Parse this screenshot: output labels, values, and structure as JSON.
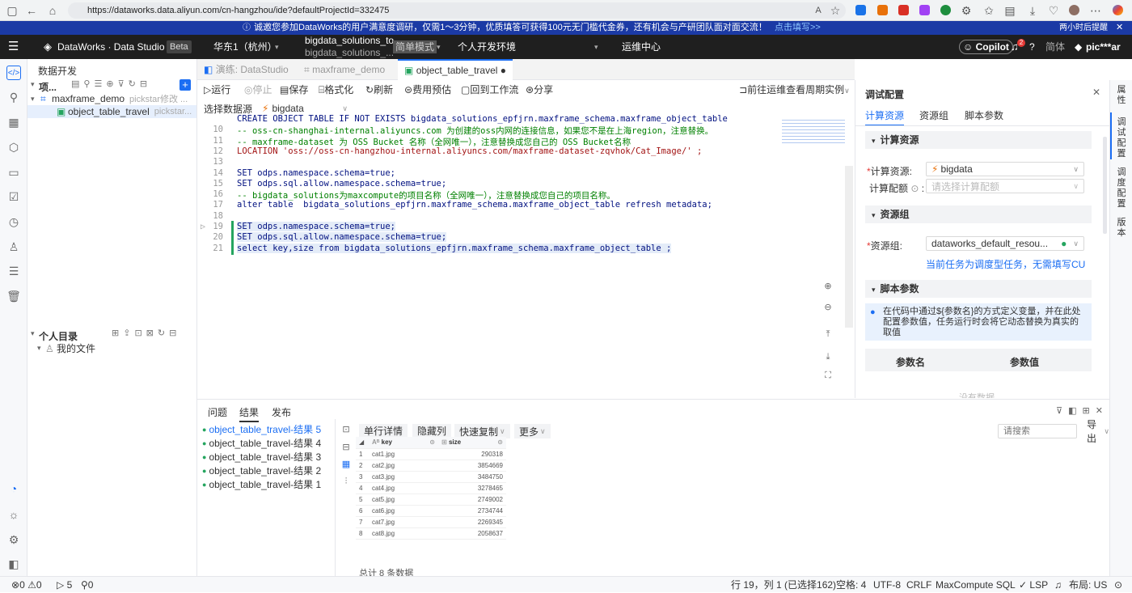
{
  "browser": {
    "url": "https://dataworks.data.aliyun.com/cn-hangzhou/ide?defaultProjectId=332475"
  },
  "banner": {
    "text": "诚邀您参加DataWorks的用户满意度调研，仅需1～3分钟，优质填答可获得100元无门槛代金券，还有机会与产研团队面对面交流！",
    "link": "点击填写>>",
    "dismiss": "两小时后提醒"
  },
  "header": {
    "product": "DataWorks · Data Studio",
    "beta": "Beta",
    "region": "华东1（杭州）",
    "project_line1": "bigdata_solutions_to",
    "project_line2": "bigdata_solutions_...",
    "mode": "简单模式",
    "env": "个人开发环境",
    "ops": "运维中心",
    "copilot": "Copilot",
    "notif_count": "2",
    "lang": "简体",
    "user": "pic***ar"
  },
  "explorer": {
    "title": "数据开发",
    "project_label": "项...",
    "tree": [
      {
        "label": "maxframe_demo",
        "meta": "pickstar修改 ..."
      },
      {
        "label": "object_table_travel",
        "meta": "pickstar..."
      }
    ],
    "personal_title": "个人目录",
    "my_files": "我的文件"
  },
  "tabs": [
    {
      "label": "演练: DataStudio"
    },
    {
      "label": "maxframe_demo"
    },
    {
      "label": "object_table_travel"
    }
  ],
  "toolbar": {
    "run": "运行",
    "stop": "停止",
    "save": "保存",
    "format": "格式化",
    "refresh": "刷新",
    "cost": "费用预估",
    "back": "回到工作流",
    "share": "分享",
    "ops_link": "前往运维查看周期实例"
  },
  "datasource": {
    "label": "选择数据源",
    "value": "bigdata"
  },
  "code": {
    "lines": [
      {
        "n": "",
        "text": "CREATE OBJECT TABLE IF NOT EXISTS bigdata_solutions_epfjrn.maxframe_schema.maxframe_object_table"
      },
      {
        "n": "10",
        "text": "-- oss-cn-shanghai-internal.aliyuncs.com 为创建的oss内网的连接信息，如果您不是在上海region，注意替换。"
      },
      {
        "n": "11",
        "text": "-- maxframe-dataset 为 OSS Bucket 名称（全网唯一），注意替换成您自己的 OSS Bucket名称"
      },
      {
        "n": "12",
        "text": "LOCATION 'oss://oss-cn-hangzhou-internal.aliyuncs.com/maxframe-dataset-zqvhok/Cat_Image/' ;"
      },
      {
        "n": "13",
        "text": ""
      },
      {
        "n": "14",
        "text": "SET odps.namespace.schema=true;"
      },
      {
        "n": "15",
        "text": "SET odps.sql.allow.namespace.schema=true;"
      },
      {
        "n": "16",
        "text": "-- bigdata_solutions为maxcompute的项目名称（全网唯一），注意替换成您自己的项目名称。"
      },
      {
        "n": "17",
        "text": "alter table  bigdata_solutions_epfjrn.maxframe_schema.maxframe_object_table refresh metadata;"
      },
      {
        "n": "18",
        "text": ""
      },
      {
        "n": "19",
        "text": "SET odps.namespace.schema=true;"
      },
      {
        "n": "20",
        "text": "SET odps.sql.allow.namespace.schema=true;"
      },
      {
        "n": "21",
        "text": "select key,size from bigdata_solutions_epfjrn.maxframe_schema.maxframe_object_table ;"
      }
    ]
  },
  "right_panel": {
    "title": "调试配置",
    "tabs": [
      "计算资源",
      "资源组",
      "脚本参数"
    ],
    "compute_section": "计算资源",
    "compute_label": "计算资源:",
    "compute_value": "bigdata",
    "quota_label": "计算配额",
    "quota_placeholder": "请选择计算配额",
    "rg_section": "资源组",
    "rg_label": "资源组:",
    "rg_value": "dataworks_default_resou...",
    "rg_hint": "当前任务为调度型任务，无需填写CU",
    "param_section": "脚本参数",
    "param_info": "在代码中通过${参数名}的方式定义变量，并在此处配置参数值，任务运行时会将它动态替换为真实的取值",
    "param_col1": "参数名",
    "param_col2": "参数值",
    "no_data": "没有数据"
  },
  "right_rail": [
    "属性",
    "调试配置",
    "调度配置",
    "版本"
  ],
  "bottom": {
    "tabs": [
      "问题",
      "结果",
      "发布"
    ],
    "results": [
      "object_table_travel-结果 5",
      "object_table_travel-结果 4",
      "object_table_travel-结果 3",
      "object_table_travel-结果 2",
      "object_table_travel-结果 1"
    ],
    "actions": {
      "row_detail": "单行详情",
      "hide_col": "隐藏列",
      "quick_copy": "快速复制",
      "more": "更多",
      "search_placeholder": "请搜索",
      "export": "导出"
    },
    "table": {
      "columns": [
        "key",
        "size"
      ],
      "rows": [
        [
          "1",
          "cat1.jpg",
          "290318"
        ],
        [
          "2",
          "cat2.jpg",
          "3854669"
        ],
        [
          "3",
          "cat3.jpg",
          "3484750"
        ],
        [
          "4",
          "cat4.jpg",
          "3278465"
        ],
        [
          "5",
          "cat5.jpg",
          "2749002"
        ],
        [
          "6",
          "cat6.jpg",
          "2734744"
        ],
        [
          "7",
          "cat7.jpg",
          "2269345"
        ],
        [
          "8",
          "cat8.jpg",
          "2058637"
        ]
      ]
    },
    "total": "总计 8 条数据"
  },
  "status": {
    "errors": "0",
    "warnings": "0",
    "ports": "5",
    "other": "0",
    "position": "行 19，列 1 (已选择162)",
    "spaces": "空格: 4",
    "encoding": "UTF-8",
    "eol": "CRLF",
    "lang": "MaxCompute SQL",
    "lsp": "LSP",
    "layout": "布局: US"
  },
  "colors": {
    "accent": "#1b6ef3",
    "header_bg": "#1f1f1f",
    "banner_bg": "#1b3aa5",
    "success": "#25a55f"
  }
}
